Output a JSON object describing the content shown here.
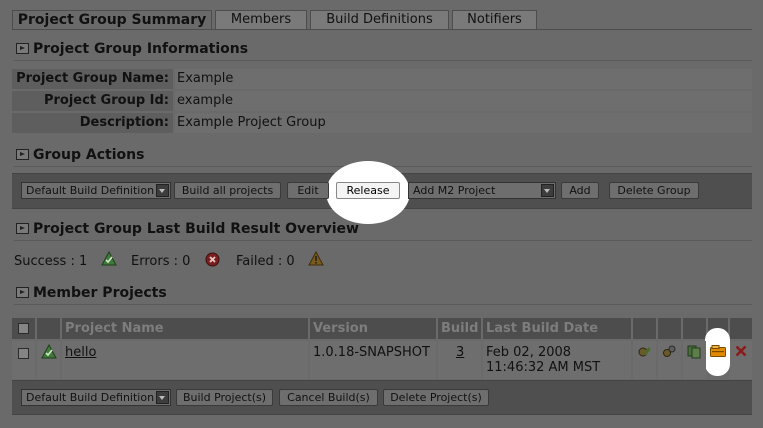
{
  "tabs": [
    {
      "label": "Project Group Summary"
    },
    {
      "label": "Members"
    },
    {
      "label": "Build Definitions"
    },
    {
      "label": "Notifiers"
    }
  ],
  "info_section": {
    "title": "Project Group Informations",
    "rows": [
      {
        "label": "Project Group Name:",
        "value": "Example"
      },
      {
        "label": "Project Group Id:",
        "value": "example"
      },
      {
        "label": "Description:",
        "value": "Example Project Group"
      }
    ]
  },
  "actions_section": {
    "title": "Group Actions",
    "build_definition_select": "Default Build Definition",
    "build_all_label": "Build all projects",
    "edit_label": "Edit",
    "release_label": "Release",
    "add_project_select": "Add M2 Project",
    "add_label": "Add",
    "delete_group_label": "Delete Group"
  },
  "overview_section": {
    "title": "Project Group Last Build Result Overview",
    "success_label": "Success : 1",
    "errors_label": "Errors : 0",
    "failed_label": "Failed : 0"
  },
  "members_section": {
    "title": "Member Projects",
    "columns": [
      "Project Name",
      "Version",
      "Build",
      "Last Build Date"
    ],
    "rows": [
      {
        "name": "hello",
        "version": "1.0.18-SNAPSHOT",
        "build": "3",
        "date_line1": "Feb 02, 2008",
        "date_line2": "11:46:32 AM MST"
      }
    ],
    "build_definition_select": "Default Build Definition",
    "build_projects_label": "Build Project(s)",
    "cancel_builds_label": "Cancel Build(s)",
    "delete_projects_label": "Delete Project(s)"
  },
  "colors": {
    "success": "#3f7a3a",
    "error": "#7a1f1f",
    "failed": "#7a5a1a",
    "delete": "#8b1a1a",
    "release_icon": "#e08a00"
  },
  "icons": [
    "success-icon",
    "error-icon",
    "failed-icon",
    "build-icon",
    "build-def-icon",
    "copy-icon",
    "release-icon",
    "delete-icon"
  ]
}
